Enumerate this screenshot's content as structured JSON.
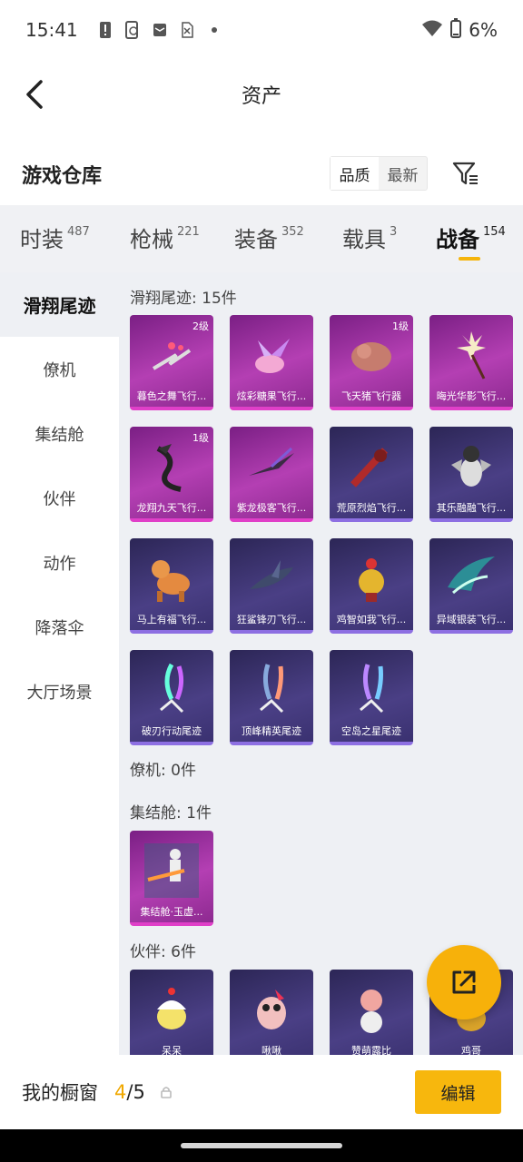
{
  "status": {
    "time": "15:41",
    "battery": "6%",
    "icons": [
      "alert-icon",
      "phone-sync-icon",
      "mail-icon",
      "sim-off-icon",
      "dot-icon"
    ]
  },
  "header": {
    "title": "资产"
  },
  "subheader": {
    "title": "游戏仓库",
    "sort_options": [
      "品质",
      "最新"
    ]
  },
  "tabs": [
    {
      "label": "时装",
      "count": "487"
    },
    {
      "label": "枪械",
      "count": "221"
    },
    {
      "label": "装备",
      "count": "352"
    },
    {
      "label": "载具",
      "count": "3"
    },
    {
      "label": "战备",
      "count": "154"
    }
  ],
  "sidebar": [
    "滑翔尾迹",
    "僚机",
    "集结舱",
    "伙伴",
    "动作",
    "降落伞",
    "大厅场景"
  ],
  "groups": {
    "glide": {
      "title": "滑翔尾迹: 15件",
      "items": [
        {
          "name": "暮色之舞飞行...",
          "level": "2级"
        },
        {
          "name": "炫彩糖果飞行..."
        },
        {
          "name": "飞天猪飞行器",
          "level": "1级"
        },
        {
          "name": "晦光华影飞行..."
        },
        {
          "name": "龙翔九天飞行...",
          "level": "1级"
        },
        {
          "name": "紫龙极客飞行..."
        },
        {
          "name": "荒原烈焰飞行..."
        },
        {
          "name": "其乐融融飞行..."
        },
        {
          "name": "马上有福飞行..."
        },
        {
          "name": "狂鲨锋刃飞行..."
        },
        {
          "name": "鸡智如我飞行..."
        },
        {
          "name": "异域银装飞行..."
        },
        {
          "name": "破刃行动尾迹"
        },
        {
          "name": "顶峰精英尾迹"
        },
        {
          "name": "空岛之星尾迹"
        }
      ]
    },
    "wingman": {
      "title": "僚机: 0件"
    },
    "pod": {
      "title": "集结舱: 1件",
      "items": [
        {
          "name": "集结舱·玉虚..."
        }
      ]
    },
    "partner": {
      "title": "伙伴: 6件",
      "items": [
        {
          "name": "呆呆"
        },
        {
          "name": "啾啾"
        },
        {
          "name": "赞萌露比"
        },
        {
          "name": "鸡哥"
        }
      ]
    }
  },
  "bottom": {
    "label": "我的橱窗",
    "current": "4",
    "total": "/5",
    "edit": "编辑"
  },
  "colors": {
    "accent": "#f7b10a",
    "purple_card": "#b43fb3",
    "blue_card": "#4a3f85"
  }
}
